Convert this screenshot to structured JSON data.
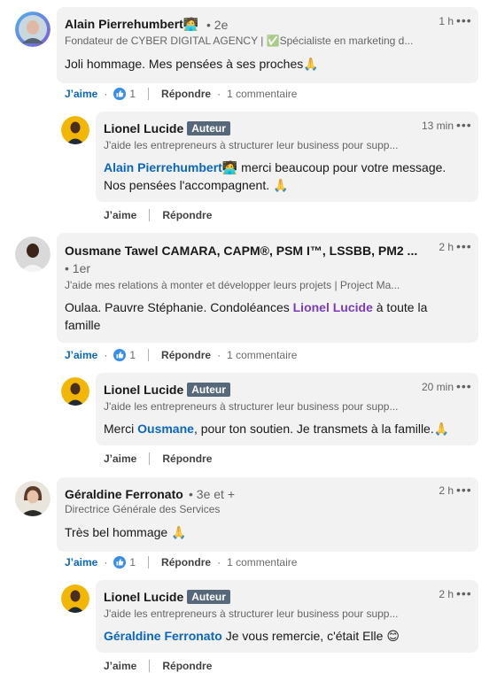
{
  "comments": [
    {
      "author": "Alain Pierrehumbert",
      "author_emoji": "🧑‍💻",
      "degree": "• 2e",
      "headline": "Fondateur de CYBER DIGITAL AGENCY | ✅Spécialiste en marketing d...",
      "time": "1 h",
      "text": "Joli hommage. Mes pensées à ses proches",
      "text_emoji": "🙏",
      "like_label": "J’aime",
      "like_count": "1",
      "reply_label": "Répondre",
      "comments_count": "1 commentaire",
      "reply": {
        "author": "Lionel Lucide",
        "badge": "Auteur",
        "headline": "J'aide les entrepreneurs à structurer leur business pour supp...",
        "time": "13 min",
        "mention": "Alain Pierrehumbert",
        "mention_emoji": "🧑‍💻",
        "text": " merci beaucoup pour votre message. Nos pensées l'accompagnent. ",
        "text_emoji": "🙏",
        "like_label": "J’aime",
        "reply_label": "Répondre"
      }
    },
    {
      "author": "Ousmane Tawel CAMARA, CAPM®, PSM I™, LSSBB, PM2 ...",
      "degree": "• 1er",
      "headline": "J'aide mes relations à monter et développer leurs projets | Project Ma...",
      "time": "2 h",
      "text_before": "Oulaa. Pauvre Stéphanie. Condoléances ",
      "mention": "Lionel Lucide",
      "text_after": " à toute la famille",
      "like_label": "J’aime",
      "like_count": "1",
      "reply_label": "Répondre",
      "comments_count": "1 commentaire",
      "reply": {
        "author": "Lionel Lucide",
        "badge": "Auteur",
        "headline": "J'aide les entrepreneurs à structurer leur business pour supp...",
        "time": "20 min",
        "text_before": "Merci ",
        "mention": "Ousmane",
        "text_after": ", pour ton soutien. Je transmets à la famille.",
        "text_emoji": "🙏",
        "like_label": "J’aime",
        "reply_label": "Répondre"
      }
    },
    {
      "author": "Géraldine Ferronato",
      "degree": "• 3e et +",
      "headline": "Directrice Générale des Services",
      "time": "2 h",
      "text": "Très bel hommage ",
      "text_emoji": "🙏",
      "like_label": "J’aime",
      "like_count": "1",
      "reply_label": "Répondre",
      "comments_count": "1 commentaire",
      "reply": {
        "author": "Lionel Lucide",
        "badge": "Auteur",
        "headline": "J'aide les entrepreneurs à structurer leur business pour supp...",
        "time": "2 h",
        "mention": "Géraldine Ferronato",
        "text": " Je vous remercie, c'était Elle ",
        "text_emoji": "😊",
        "like_label": "J’aime",
        "reply_label": "Répondre"
      }
    }
  ],
  "more_icon": "•••",
  "colors": {
    "link": "#0a66c2",
    "mention_purple": "#7a3bb8",
    "bubble": "#f2f2f2",
    "badge": "#56687a"
  }
}
